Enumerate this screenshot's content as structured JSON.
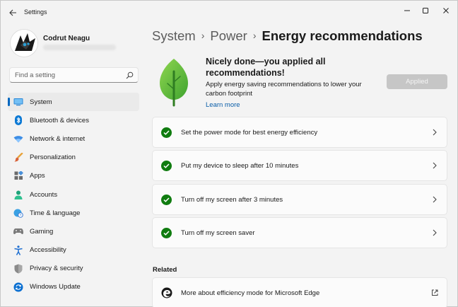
{
  "window": {
    "title": "Settings"
  },
  "profile": {
    "name": "Codrut Neagu"
  },
  "search": {
    "placeholder": "Find a setting"
  },
  "sidebar": {
    "items": [
      {
        "label": "System",
        "icon": "system-icon",
        "active": true
      },
      {
        "label": "Bluetooth & devices",
        "icon": "bluetooth-icon"
      },
      {
        "label": "Network & internet",
        "icon": "wifi-icon"
      },
      {
        "label": "Personalization",
        "icon": "brush-icon"
      },
      {
        "label": "Apps",
        "icon": "apps-icon"
      },
      {
        "label": "Accounts",
        "icon": "person-icon"
      },
      {
        "label": "Time & language",
        "icon": "globe-clock-icon"
      },
      {
        "label": "Gaming",
        "icon": "gamepad-icon"
      },
      {
        "label": "Accessibility",
        "icon": "accessibility-icon"
      },
      {
        "label": "Privacy & security",
        "icon": "shield-icon"
      },
      {
        "label": "Windows Update",
        "icon": "update-icon"
      }
    ]
  },
  "breadcrumb": {
    "level1": "System",
    "level2": "Power",
    "current": "Energy recommendations",
    "separator": "›"
  },
  "hero": {
    "title": "Nicely done—you applied all recommendations!",
    "description": "Apply energy saving recommendations to lower your carbon footprint",
    "link": "Learn more",
    "button": "Applied"
  },
  "recommendations": [
    {
      "label": "Set the power mode for best energy efficiency"
    },
    {
      "label": "Put my device to sleep after 10 minutes"
    },
    {
      "label": "Turn off my screen after 3 minutes"
    },
    {
      "label": "Turn off my screen saver"
    }
  ],
  "related": {
    "heading": "Related",
    "items": [
      {
        "label": "More about efficiency mode for Microsoft Edge"
      }
    ]
  },
  "colors": {
    "accent": "#0067c0",
    "check_green": "#107c10",
    "leaf_green": "#6cc24a"
  }
}
